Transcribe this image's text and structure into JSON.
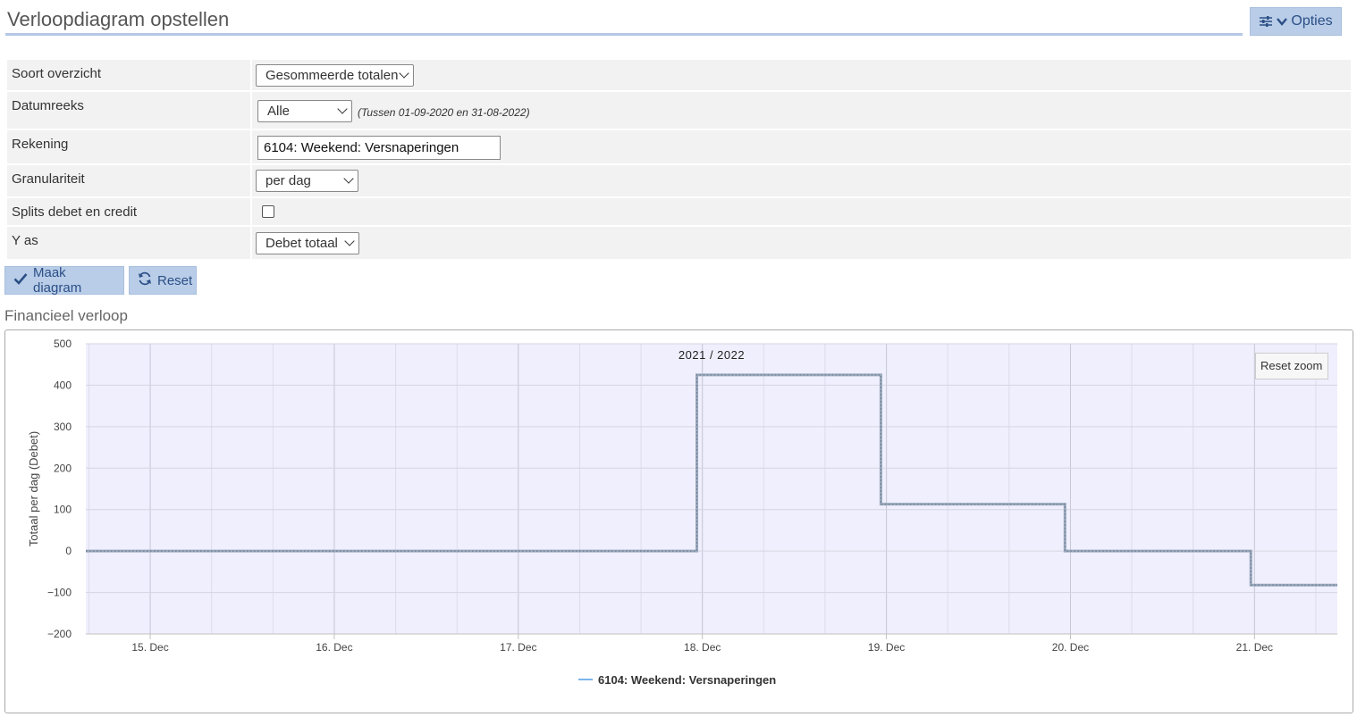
{
  "header": {
    "title": "Verloopdiagram opstellen",
    "options_label": "Opties",
    "options_icons": [
      "sliders-icon",
      "chevron-down-icon"
    ]
  },
  "form": {
    "soort_overzicht": {
      "label": "Soort overzicht",
      "value": "Gesommeerde totalen"
    },
    "datumreeks": {
      "label": "Datumreeks",
      "value": "Alle",
      "note": "(Tussen 01-09-2020 en 31-08-2022)"
    },
    "rekening": {
      "label": "Rekening",
      "value": "6104: Weekend: Versnaperingen"
    },
    "granulariteit": {
      "label": "Granulariteit",
      "value": "per dag"
    },
    "splits": {
      "label": "Splits debet en credit",
      "checked": false
    },
    "y_as": {
      "label": "Y as",
      "value": "Debet totaal"
    }
  },
  "buttons": {
    "maak": "Maak diagram",
    "reset": "Reset"
  },
  "section_title": "Financieel verloop",
  "reset_zoom": "Reset zoom",
  "colors": {
    "accent_button": "#b9cde8",
    "accent_text": "#2b4f86",
    "plot_background": "#efeffd",
    "series_line": "#9aa8bc",
    "legend_line": "#7cb5ec"
  },
  "chart_data": {
    "type": "line",
    "step": true,
    "title": "2021 / 2022",
    "ylabel": "Totaal per dag (Debet)",
    "xlabel": "",
    "ylim": [
      -200,
      500
    ],
    "yticks": [
      500,
      400,
      300,
      200,
      100,
      0,
      -100,
      -200
    ],
    "yticklabels": [
      "500",
      "400",
      "300",
      "200",
      "100",
      "0",
      "−100",
      "−200"
    ],
    "x_range": [
      14.65,
      21.45
    ],
    "xticks": [
      15,
      16,
      17,
      18,
      19,
      20,
      21
    ],
    "xticklabels": [
      "15. Dec",
      "16. Dec",
      "17. Dec",
      "18. Dec",
      "19. Dec",
      "20. Dec",
      "21. Dec"
    ],
    "grid": true,
    "legend": "bottom-center",
    "series": [
      {
        "name": "6104: Weekend: Versnaperingen",
        "points": [
          [
            14.65,
            0
          ],
          [
            17.97,
            0
          ],
          [
            17.97,
            425
          ],
          [
            18.97,
            425
          ],
          [
            18.97,
            113
          ],
          [
            19.97,
            113
          ],
          [
            19.97,
            0
          ],
          [
            20.98,
            0
          ],
          [
            20.98,
            -82
          ],
          [
            21.45,
            -82
          ]
        ]
      }
    ]
  }
}
